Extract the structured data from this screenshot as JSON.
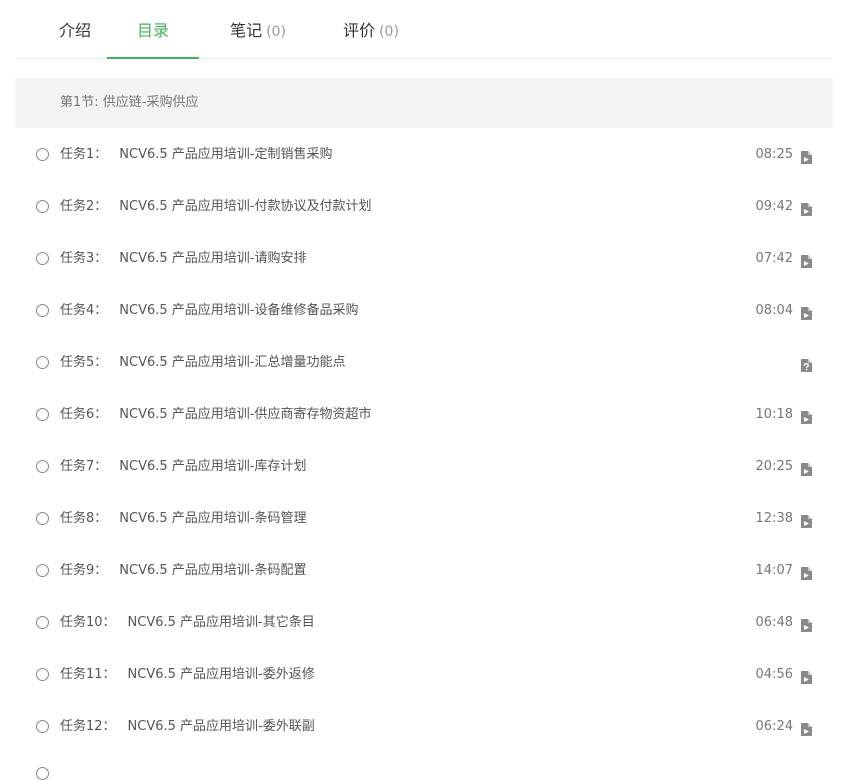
{
  "tabs": [
    {
      "label": "介绍",
      "count": ""
    },
    {
      "label": "目录",
      "count": ""
    },
    {
      "label": "笔记",
      "count": "(0)"
    },
    {
      "label": "评价",
      "count": "(0)"
    }
  ],
  "active_tab": "目录",
  "section": {
    "title": "第1节: 供应链-采购供应"
  },
  "tasks": [
    {
      "num": "任务1：",
      "title": "NCV6.5 产品应用培训-定制销售采购",
      "duration": "08:25",
      "icon": "video-file-icon"
    },
    {
      "num": "任务2：",
      "title": "NCV6.5 产品应用培训-付款协议及付款计划",
      "duration": "09:42",
      "icon": "video-file-icon"
    },
    {
      "num": "任务3：",
      "title": "NCV6.5 产品应用培训-请购安排",
      "duration": "07:42",
      "icon": "video-file-icon"
    },
    {
      "num": "任务4：",
      "title": "NCV6.5 产品应用培训-设备维修备品采购",
      "duration": "08:04",
      "icon": "video-file-icon"
    },
    {
      "num": "任务5：",
      "title": "NCV6.5 产品应用培训-汇总增量功能点",
      "duration": "",
      "icon": "document-file-icon"
    },
    {
      "num": "任务6：",
      "title": "NCV6.5 产品应用培训-供应商寄存物资超市",
      "duration": "10:18",
      "icon": "video-file-icon"
    },
    {
      "num": "任务7：",
      "title": "NCV6.5 产品应用培训-库存计划",
      "duration": "20:25",
      "icon": "video-file-icon"
    },
    {
      "num": "任务8：",
      "title": "NCV6.5 产品应用培训-条码管理",
      "duration": "12:38",
      "icon": "video-file-icon"
    },
    {
      "num": "任务9：",
      "title": "NCV6.5 产品应用培训-条码配置",
      "duration": "14:07",
      "icon": "video-file-icon"
    },
    {
      "num": "任务10：",
      "title": "NCV6.5 产品应用培训-其它条目",
      "duration": "06:48",
      "icon": "video-file-icon"
    },
    {
      "num": "任务11：",
      "title": "NCV6.5 产品应用培训-委外返修",
      "duration": "04:56",
      "icon": "video-file-icon"
    },
    {
      "num": "任务12：",
      "title": "NCV6.5 产品应用培训-委外联副",
      "duration": "06:24",
      "icon": "video-file-icon"
    }
  ],
  "colors": {
    "accent": "#45b05a",
    "section_bg": "#f3f3f3",
    "text": "#555555",
    "muted": "#777777"
  }
}
